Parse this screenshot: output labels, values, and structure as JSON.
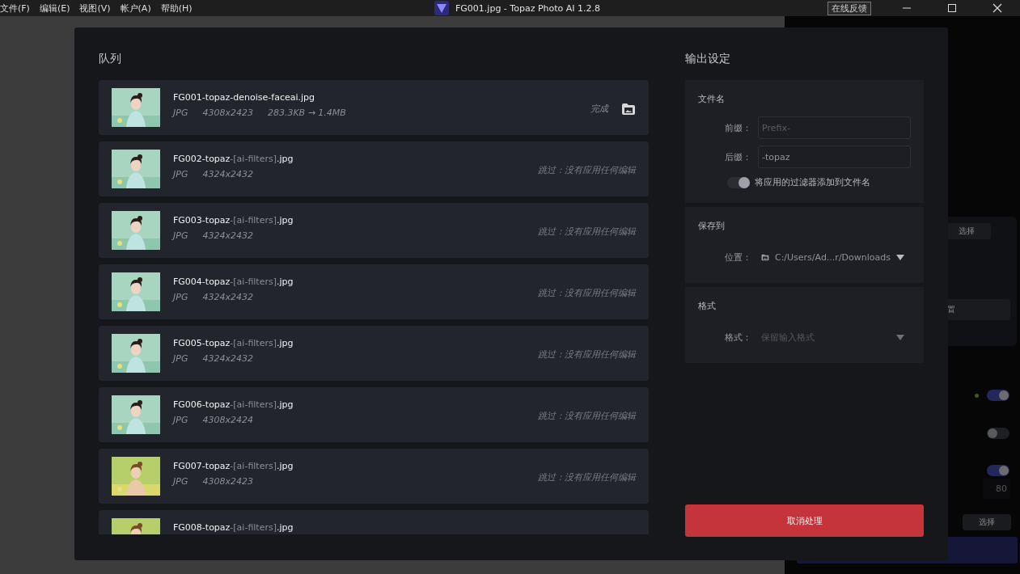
{
  "window": {
    "title": "FG001.jpg - Topaz Photo AI 1.2.8",
    "menu": [
      "文件(F)",
      "编辑(E)",
      "视图(V)",
      "帐户(A)",
      "帮助(H)"
    ],
    "feedback_button": "在线反馈"
  },
  "background": {
    "select_button": "选择",
    "settings_button": "置",
    "toggles": [
      {
        "on": true,
        "dot": true
      },
      {
        "on": false
      },
      {
        "on": true
      }
    ],
    "strength_value": "80",
    "select_button_2": "选择"
  },
  "queue": {
    "title": "队列",
    "items": [
      {
        "name": "FG001-topaz-denoise-faceai.jpg",
        "format": "JPG",
        "size": "4308x2423",
        "filesize": "283.3KB → 1.4MB",
        "status": "完成",
        "done": true
      },
      {
        "name": "FG002-topaz",
        "filter_tag": "-[ai-filters]",
        "ext": ".jpg",
        "format": "JPG",
        "size": "4324x2432",
        "status": "跳过：没有应用任何编辑",
        "done": false
      },
      {
        "name": "FG003-topaz",
        "filter_tag": "-[ai-filters]",
        "ext": ".jpg",
        "format": "JPG",
        "size": "4324x2432",
        "status": "跳过：没有应用任何编辑",
        "done": false
      },
      {
        "name": "FG004-topaz",
        "filter_tag": "-[ai-filters]",
        "ext": ".jpg",
        "format": "JPG",
        "size": "4324x2432",
        "status": "跳过：没有应用任何编辑",
        "done": false
      },
      {
        "name": "FG005-topaz",
        "filter_tag": "-[ai-filters]",
        "ext": ".jpg",
        "format": "JPG",
        "size": "4324x2432",
        "status": "跳过：没有应用任何编辑",
        "done": false
      },
      {
        "name": "FG006-topaz",
        "filter_tag": "-[ai-filters]",
        "ext": ".jpg",
        "format": "JPG",
        "size": "4308x2424",
        "status": "跳过：没有应用任何编辑",
        "done": false
      },
      {
        "name": "FG007-topaz",
        "filter_tag": "-[ai-filters]",
        "ext": ".jpg",
        "format": "JPG",
        "size": "4308x2423",
        "status": "跳过：没有应用任何编辑",
        "done": false
      },
      {
        "name": "FG008-topaz",
        "filter_tag": "-[ai-filters]",
        "ext": ".jpg"
      }
    ]
  },
  "output": {
    "title": "输出设定",
    "filename": {
      "title": "文件名",
      "prefix_label": "前缀：",
      "prefix_placeholder": "Prefix-",
      "suffix_label": "后缀：",
      "suffix_value": "-topaz",
      "add_filters": {
        "label": "将应用的过滤器添加到文件名",
        "on": true,
        "disabled": true
      }
    },
    "save_to": {
      "title": "保存到",
      "location_label": "位置：",
      "location": "C:/Users/Ad...r/Downloads"
    },
    "format": {
      "title": "格式",
      "format_label": "格式：",
      "format_value": "保留输入格式"
    },
    "cancel_button": "取消处理"
  }
}
